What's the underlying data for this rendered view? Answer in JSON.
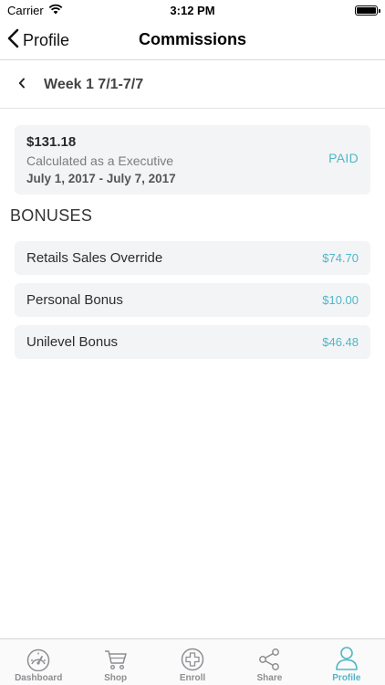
{
  "status_bar": {
    "carrier": "Carrier",
    "time": "3:12 PM"
  },
  "nav": {
    "back_label": "Profile",
    "title": "Commissions"
  },
  "week": {
    "title": "Week 1 7/1-7/7"
  },
  "summary": {
    "amount": "$131.18",
    "calculated_as": "Calculated as a Executive",
    "date_range": "July 1, 2017 - July 7, 2017",
    "status": "PAID"
  },
  "bonuses": {
    "section_title": "BONUSES",
    "items": [
      {
        "label": "Retails Sales Override",
        "amount": "$74.70"
      },
      {
        "label": "Personal Bonus",
        "amount": "$10.00"
      },
      {
        "label": "Unilevel Bonus",
        "amount": "$46.48"
      }
    ]
  },
  "tab_bar": {
    "tabs": [
      {
        "label": "Dashboard",
        "icon": "dashboard-gauge-icon"
      },
      {
        "label": "Shop",
        "icon": "cart-icon"
      },
      {
        "label": "Enroll",
        "icon": "plus-circle-icon"
      },
      {
        "label": "Share",
        "icon": "share-icon"
      },
      {
        "label": "Profile",
        "icon": "person-icon"
      }
    ],
    "active": "Profile"
  },
  "colors": {
    "accent": "#4fb7c7",
    "card_background": "#f3f4f6",
    "inactive_tab": "#8e8e93"
  }
}
